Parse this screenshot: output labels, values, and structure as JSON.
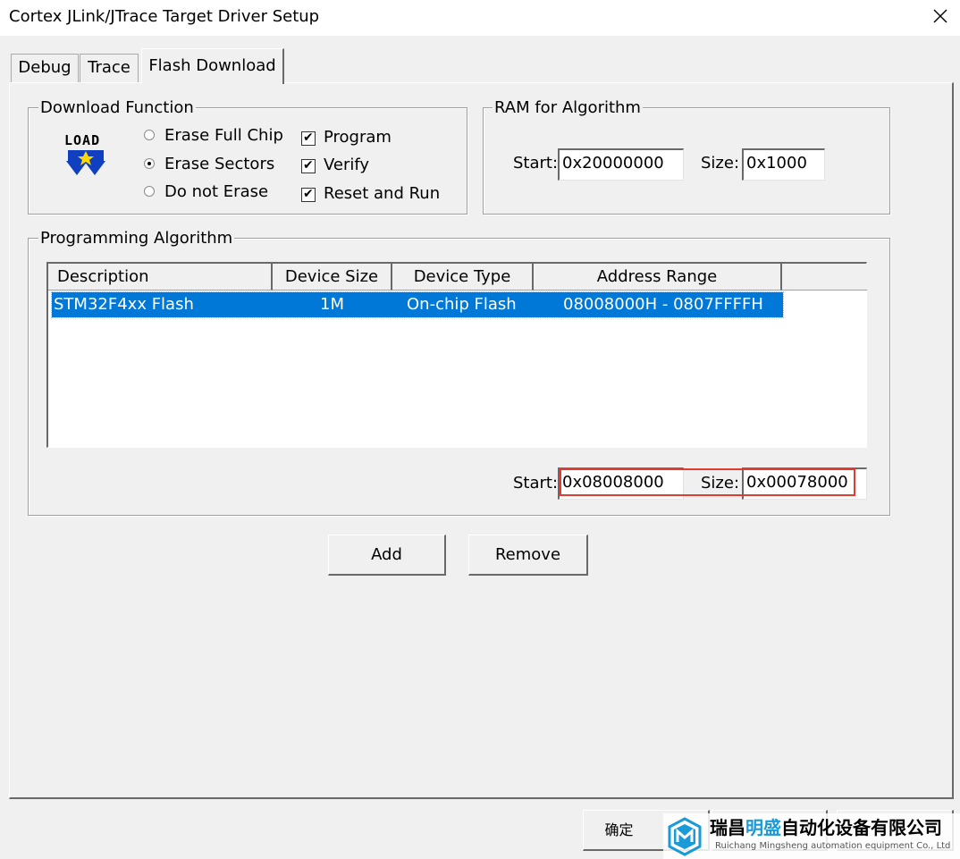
{
  "window": {
    "title": "Cortex JLink/JTrace Target Driver Setup"
  },
  "tabs": [
    {
      "label": "Debug"
    },
    {
      "label": "Trace"
    },
    {
      "label": "Flash Download",
      "active": true
    }
  ],
  "download_function": {
    "legend": "Download Function",
    "load_icon_text": "LOAD",
    "erase_options": [
      {
        "label": "Erase Full Chip",
        "selected": false
      },
      {
        "label": "Erase Sectors",
        "selected": true
      },
      {
        "label": "Do not Erase",
        "selected": false
      }
    ],
    "checkboxes": [
      {
        "label": "Program",
        "checked": true
      },
      {
        "label": "Verify",
        "checked": true
      },
      {
        "label": "Reset and Run",
        "checked": true
      }
    ]
  },
  "ram_for_algorithm": {
    "legend": "RAM for Algorithm",
    "start_label": "Start:",
    "start_value": "0x20000000",
    "size_label": "Size:",
    "size_value": "0x1000"
  },
  "programming_algorithm": {
    "legend": "Programming Algorithm",
    "columns": [
      "Description",
      "Device Size",
      "Device Type",
      "Address Range"
    ],
    "rows": [
      {
        "description": "STM32F4xx Flash",
        "device_size": "1M",
        "device_type": "On-chip Flash",
        "address_range": "08008000H - 0807FFFFH",
        "selected": true
      }
    ],
    "start_label": "Start:",
    "start_value": "0x08008000",
    "size_label": "Size:",
    "size_value": "0x00078000",
    "highlight_color": "#e03c31"
  },
  "buttons": {
    "add": "Add",
    "remove": "Remove",
    "ok": "确定"
  },
  "watermark": {
    "company_prefix": "瑞昌",
    "company_highlight": "明盛",
    "company_suffix": "自动化设备有限公司",
    "company_en": "Ruichang Mingsheng automation equipment Co., Ltd",
    "accent": "#1a9ad6"
  },
  "colors": {
    "selection": "#0078d7",
    "dialog_bg": "#f0f0f0"
  }
}
